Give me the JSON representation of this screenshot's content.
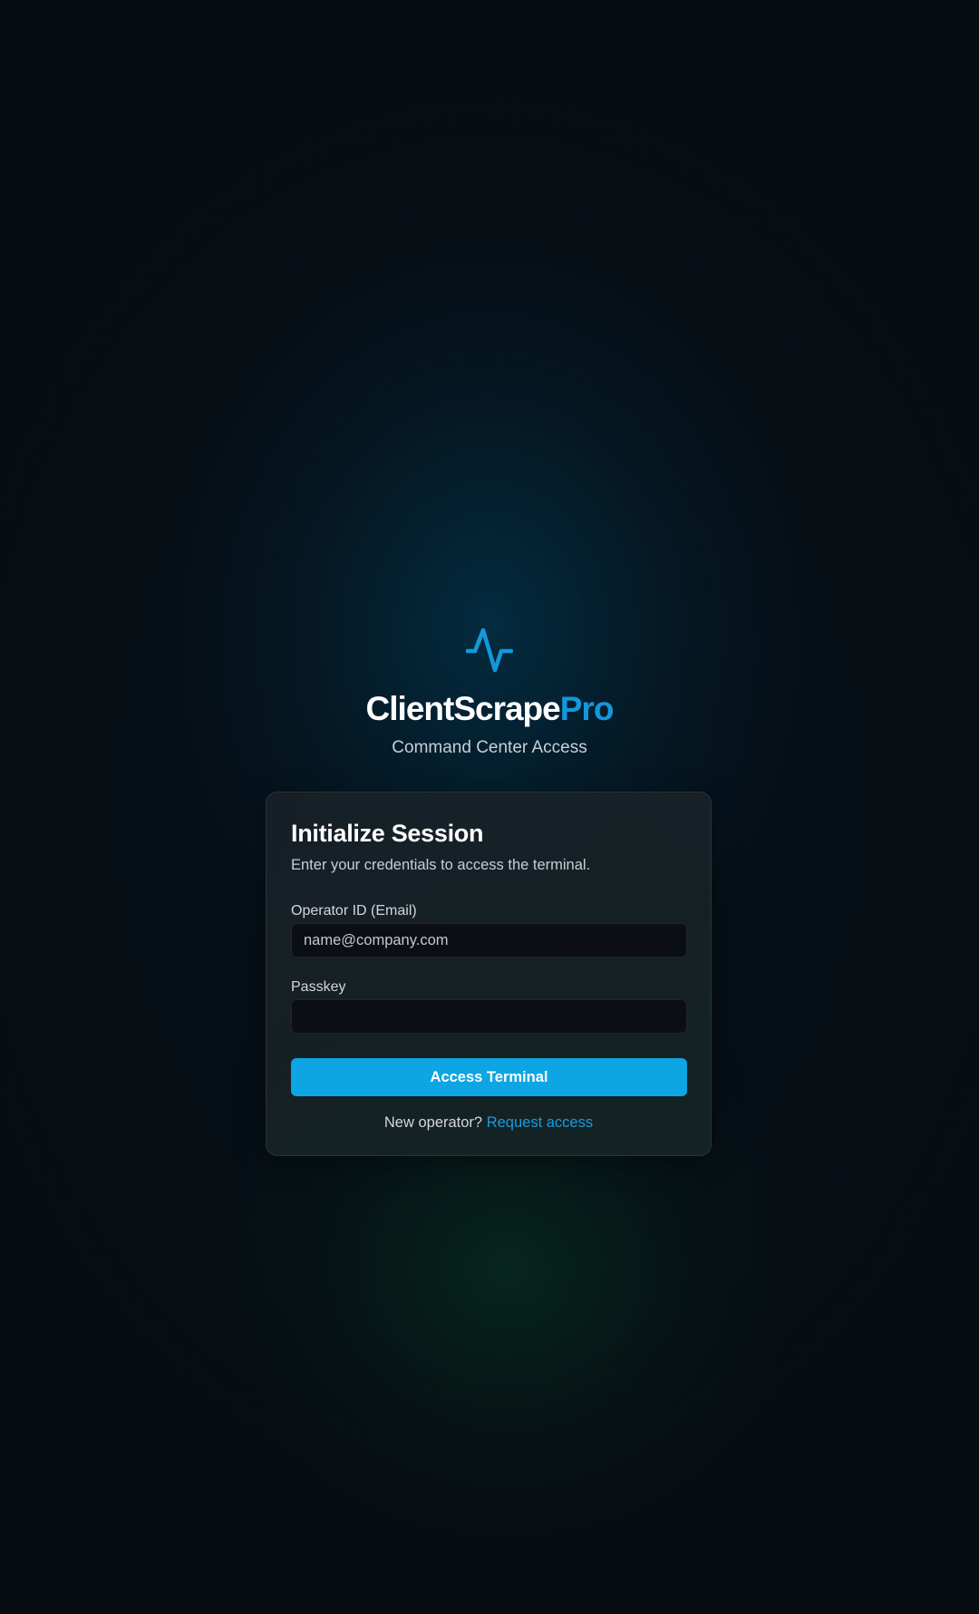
{
  "brand": {
    "logo_icon": "pulse-icon",
    "name_main": "ClientScrape",
    "name_accent": "Pro",
    "tagline": "Command Center Access",
    "accent_color": "#1498db"
  },
  "login_card": {
    "title": "Initialize Session",
    "subtitle": "Enter your credentials to access the terminal.",
    "email": {
      "label": "Operator ID (Email)",
      "placeholder": "name@company.com",
      "value": ""
    },
    "passkey": {
      "label": "Passkey",
      "placeholder": "",
      "value": ""
    },
    "submit_label": "Access Terminal",
    "submit_color": "#0ea5e4",
    "footer_prompt": "New operator?",
    "footer_link_label": "Request access"
  }
}
